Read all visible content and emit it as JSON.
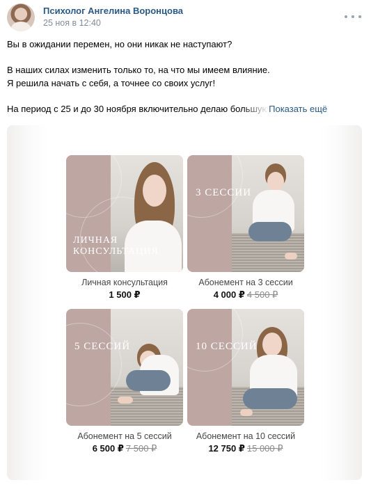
{
  "header": {
    "author": "Психолог Ангелина Воронцова",
    "date": "25 ноя в 12:40"
  },
  "post": {
    "lines": [
      "Вы в ожидании перемен, но они никак не наступают?",
      "В наших силах изменить только то, на что мы имеем влияние.",
      "Я решила начать с себя, а точнее со своих услуг!",
      "На период с 25 и до 30 ноября включительно делаю большую"
    ],
    "show_more": "Показать ещё"
  },
  "cards": [
    {
      "overlay": "ЛИЧНАЯ\nКОНСУЛЬТАЦИЯ",
      "caption": "Личная консультация",
      "price": "1 500 ₽",
      "old_price": ""
    },
    {
      "overlay": "3 СЕССИИ",
      "caption": "Абонемент на 3 сессии",
      "price": "4 000 ₽",
      "old_price": "4 500 ₽"
    },
    {
      "overlay": "5 СЕССИЙ",
      "caption": "Абонемент на 5 сессий",
      "price": "6 500 ₽",
      "old_price": "7 500 ₽"
    },
    {
      "overlay": "10 СЕССИЙ",
      "caption": "Абонемент на 10 сессий",
      "price": "12 750 ₽",
      "old_price": "15 000 ₽"
    }
  ],
  "colors": {
    "link": "#2a5885",
    "meta": "#818c99",
    "card_bg": "#bea6a3"
  },
  "icons": {
    "more": "more-horizontal-icon",
    "avatar": "avatar-photo"
  }
}
